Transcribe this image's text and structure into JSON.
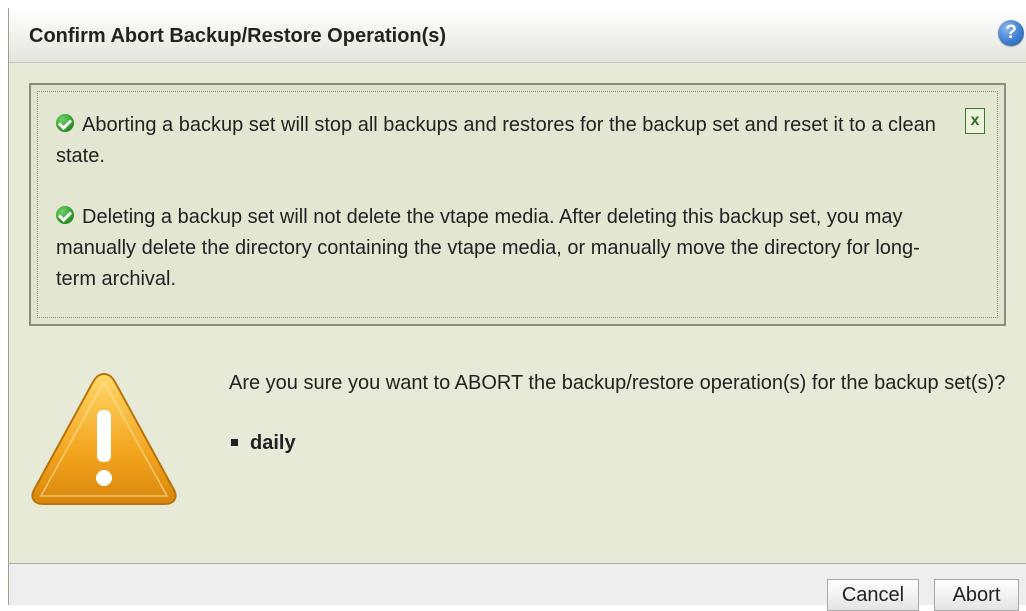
{
  "dialog": {
    "title": "Confirm Abort Backup/Restore Operation(s)",
    "help_icon": "help-icon",
    "help_glyph": "?"
  },
  "messages": {
    "close_label": "x",
    "items": [
      {
        "icon": "check-icon",
        "text": "Aborting a backup set will stop all backups and restores for the backup set and reset it to a clean state."
      },
      {
        "icon": "check-icon",
        "text": "Deleting a backup set will not delete the vtape media. After deleting this backup set, you may manually delete the directory containing the vtape media, or manually move the directory for long-term archival."
      }
    ]
  },
  "confirm": {
    "icon": "warning-icon",
    "question": "Are you sure you want to ABORT the backup/restore operation(s) for the backup set(s)?",
    "backup_sets": [
      "daily"
    ]
  },
  "buttons": {
    "cancel_label": "Cancel",
    "abort_label": "Abort"
  },
  "colors": {
    "dialog_bg": "#e6ead6",
    "check_green": "#2f9a2a",
    "warning_orange": "#f0a020"
  }
}
